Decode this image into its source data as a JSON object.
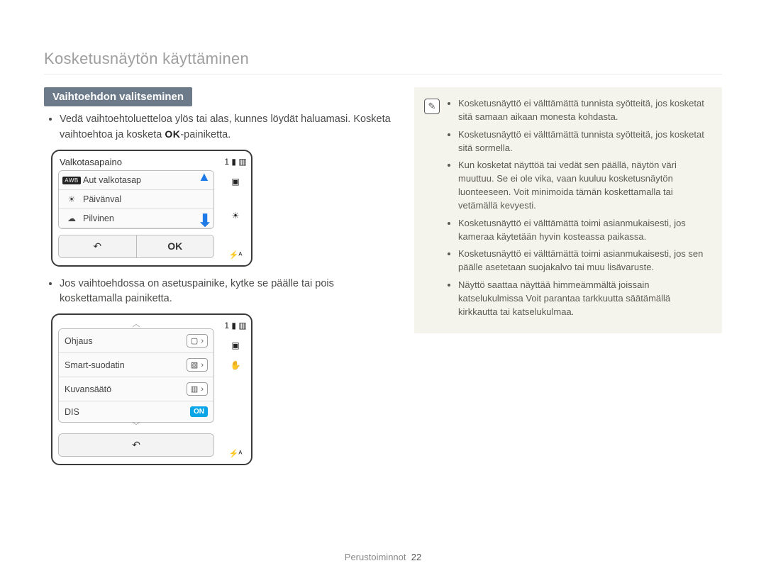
{
  "page": {
    "title": "Kosketusnäytön käyttäminen",
    "footer_label": "Perustoiminnot",
    "footer_page": "22"
  },
  "section": {
    "heading": "Vaihtoehdon valitseminen",
    "bullet1_pre": "Vedä vaihtoehtoluetteloa ylös tai alas, kunnes löydät haluamasi. Kosketa vaihtoehtoa ja kosketa ",
    "bullet1_post": "-painiketta.",
    "ok_glyph": "OK",
    "bullet2": "Jos vaihtoehdossa on asetuspainike, kytke se päälle tai pois koskettamalla painiketta."
  },
  "device1": {
    "title": "Valkotasapaino",
    "counter": "1",
    "items": [
      {
        "icon": "AWB",
        "label": "Aut valkotasap"
      },
      {
        "icon": "sun",
        "label": "Päivänval"
      },
      {
        "icon": "cloud",
        "label": "Pilvinen"
      }
    ],
    "back": "↶",
    "ok_label": "OK"
  },
  "device2": {
    "counter": "1",
    "rows": [
      {
        "label": "Ohjaus",
        "pill_icon": "▢",
        "chevron": "›"
      },
      {
        "label": "Smart-suodatin",
        "pill_icon": "▧",
        "chevron": "›"
      },
      {
        "label": "Kuvansäätö",
        "pill_icon": "▥",
        "chevron": "›"
      },
      {
        "label": "DIS",
        "on": "ON"
      }
    ],
    "back": "↶"
  },
  "note": {
    "icon_label": "✎",
    "items": [
      "Kosketusnäyttö ei välttämättä tunnista syötteitä, jos kosketat sitä samaan aikaan monesta kohdasta.",
      "Kosketusnäyttö ei välttämättä tunnista syötteitä, jos kosketat sitä sormella.",
      "Kun kosketat näyttöä tai vedät sen päällä, näytön väri muuttuu. Se ei ole vika, vaan kuuluu kosketusnäytön luonteeseen. Voit minimoida tämän koskettamalla tai vetämällä kevyesti.",
      "Kosketusnäyttö ei välttämättä toimi asianmukaisesti, jos kameraa käytetään hyvin kosteassa paikassa.",
      "Kosketusnäyttö ei välttämättä toimi asianmukaisesti, jos sen päälle asetetaan suojakalvo tai muu lisävaruste.",
      "Näyttö saattaa näyttää himmeämmältä joissain katselukulmissa Voit parantaa tarkkuutta säätämällä kirkkautta tai katselukulmaa."
    ]
  },
  "side_icons": {
    "storage": "▮",
    "battery": "▥",
    "focus": "▣",
    "sun": "☀",
    "hand": "✋",
    "flash": "⚡ᴬ"
  }
}
